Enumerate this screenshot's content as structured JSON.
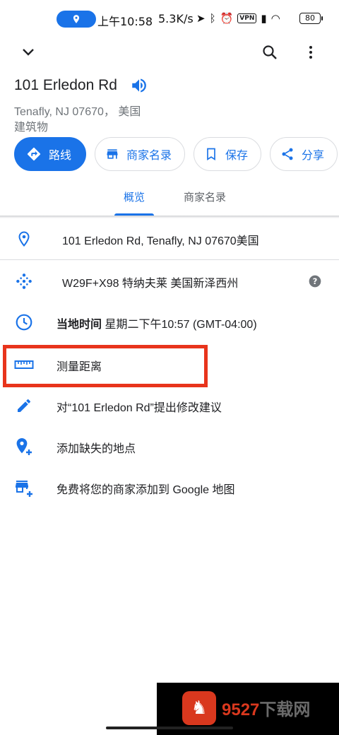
{
  "status_bar": {
    "time": "上午10:58",
    "speed": "5.3K/s",
    "vpn": "VPN",
    "battery": "80"
  },
  "place": {
    "name": "101 Erledon Rd",
    "locality": "Tenafly, NJ 07670， 美国",
    "category": "建筑物"
  },
  "actions": [
    {
      "label": "路线",
      "icon": "directions-icon"
    },
    {
      "label": "商家名录",
      "icon": "storefront-icon"
    },
    {
      "label": "保存",
      "icon": "bookmark-icon"
    },
    {
      "label": "分享",
      "icon": "share-icon"
    }
  ],
  "tabs": [
    "概览",
    "商家名录"
  ],
  "details": {
    "address": "101 Erledon Rd, Tenafly, NJ 07670美国",
    "plus_code": "W29F+X98 特纳夫莱 美国新泽西州",
    "local_time_label": "当地时间",
    "local_time_value": "星期二下午10:57 (GMT-04:00)",
    "measure": "测量距离",
    "suggest_edit": "对“101 Erledon Rd”提出修改建议",
    "add_place": "添加缺失的地点",
    "add_business": "免费将您的商家添加到 Google 地图"
  },
  "watermark": {
    "number": "9527",
    "rest": "下载网"
  },
  "colors": {
    "accent": "#1a73e8",
    "highlight": "#e8341c"
  }
}
